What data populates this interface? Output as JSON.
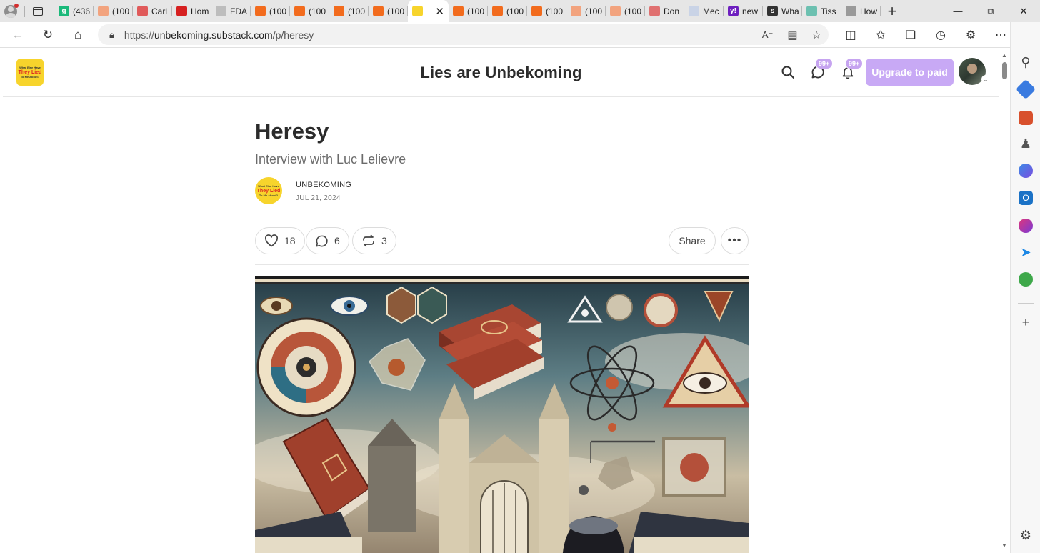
{
  "browser": {
    "tabs": [
      {
        "label": "(436",
        "color": "#1bb97a",
        "glyph": "g"
      },
      {
        "label": "(100",
        "color": "#f2a37e",
        "glyph": ""
      },
      {
        "label": "Carl",
        "color": "#e05a5a",
        "glyph": ""
      },
      {
        "label": "Hom",
        "color": "#d62020",
        "glyph": ""
      },
      {
        "label": "FDA",
        "color": "#bdbdbd",
        "glyph": ""
      },
      {
        "label": "(100",
        "color": "#f26b1d",
        "glyph": ""
      },
      {
        "label": "(100",
        "color": "#f26b1d",
        "glyph": ""
      },
      {
        "label": "(100",
        "color": "#f26b1d",
        "glyph": ""
      },
      {
        "label": "(100",
        "color": "#f26b1d",
        "glyph": ""
      }
    ],
    "active_tab_close": "✕",
    "tabs_after": [
      {
        "label": "(100",
        "color": "#f26b1d",
        "glyph": ""
      },
      {
        "label": "(100",
        "color": "#f26b1d",
        "glyph": ""
      },
      {
        "label": "(100",
        "color": "#f26b1d",
        "glyph": ""
      },
      {
        "label": "(100",
        "color": "#f2a37e",
        "glyph": ""
      },
      {
        "label": "(100",
        "color": "#f2a37e",
        "glyph": ""
      },
      {
        "label": "Don",
        "color": "#e07070",
        "glyph": ""
      },
      {
        "label": "Mec",
        "color": "#c9d3e6",
        "glyph": ""
      },
      {
        "label": "new",
        "color": "#6d1fbf",
        "glyph": "y!"
      },
      {
        "label": "Wha",
        "color": "#333333",
        "glyph": "s"
      },
      {
        "label": "Tiss",
        "color": "#6cc0b0",
        "glyph": ""
      },
      {
        "label": "How",
        "color": "#9a9a9a",
        "glyph": ""
      }
    ],
    "url_prefix": "https://",
    "url_host": "unbekoming.substack.com",
    "url_path": "/p/heresy"
  },
  "site": {
    "title": "Lies are Unbekoming",
    "logo_line1": "What Else Have",
    "logo_line2": "They Lied",
    "logo_line3": "To Me About?",
    "chat_badge": "99+",
    "bell_badge": "99+",
    "upgrade_label": "Upgrade to paid"
  },
  "post": {
    "title": "Heresy",
    "subtitle": "Interview with Luc Lelievre",
    "author": "UNBEKOMING",
    "date": "JUL 21, 2024",
    "likes": "18",
    "comments": "6",
    "restacks": "3",
    "share_label": "Share"
  },
  "colors": {
    "accent": "#c8a9f5",
    "logo_yellow": "#f7d42c"
  }
}
